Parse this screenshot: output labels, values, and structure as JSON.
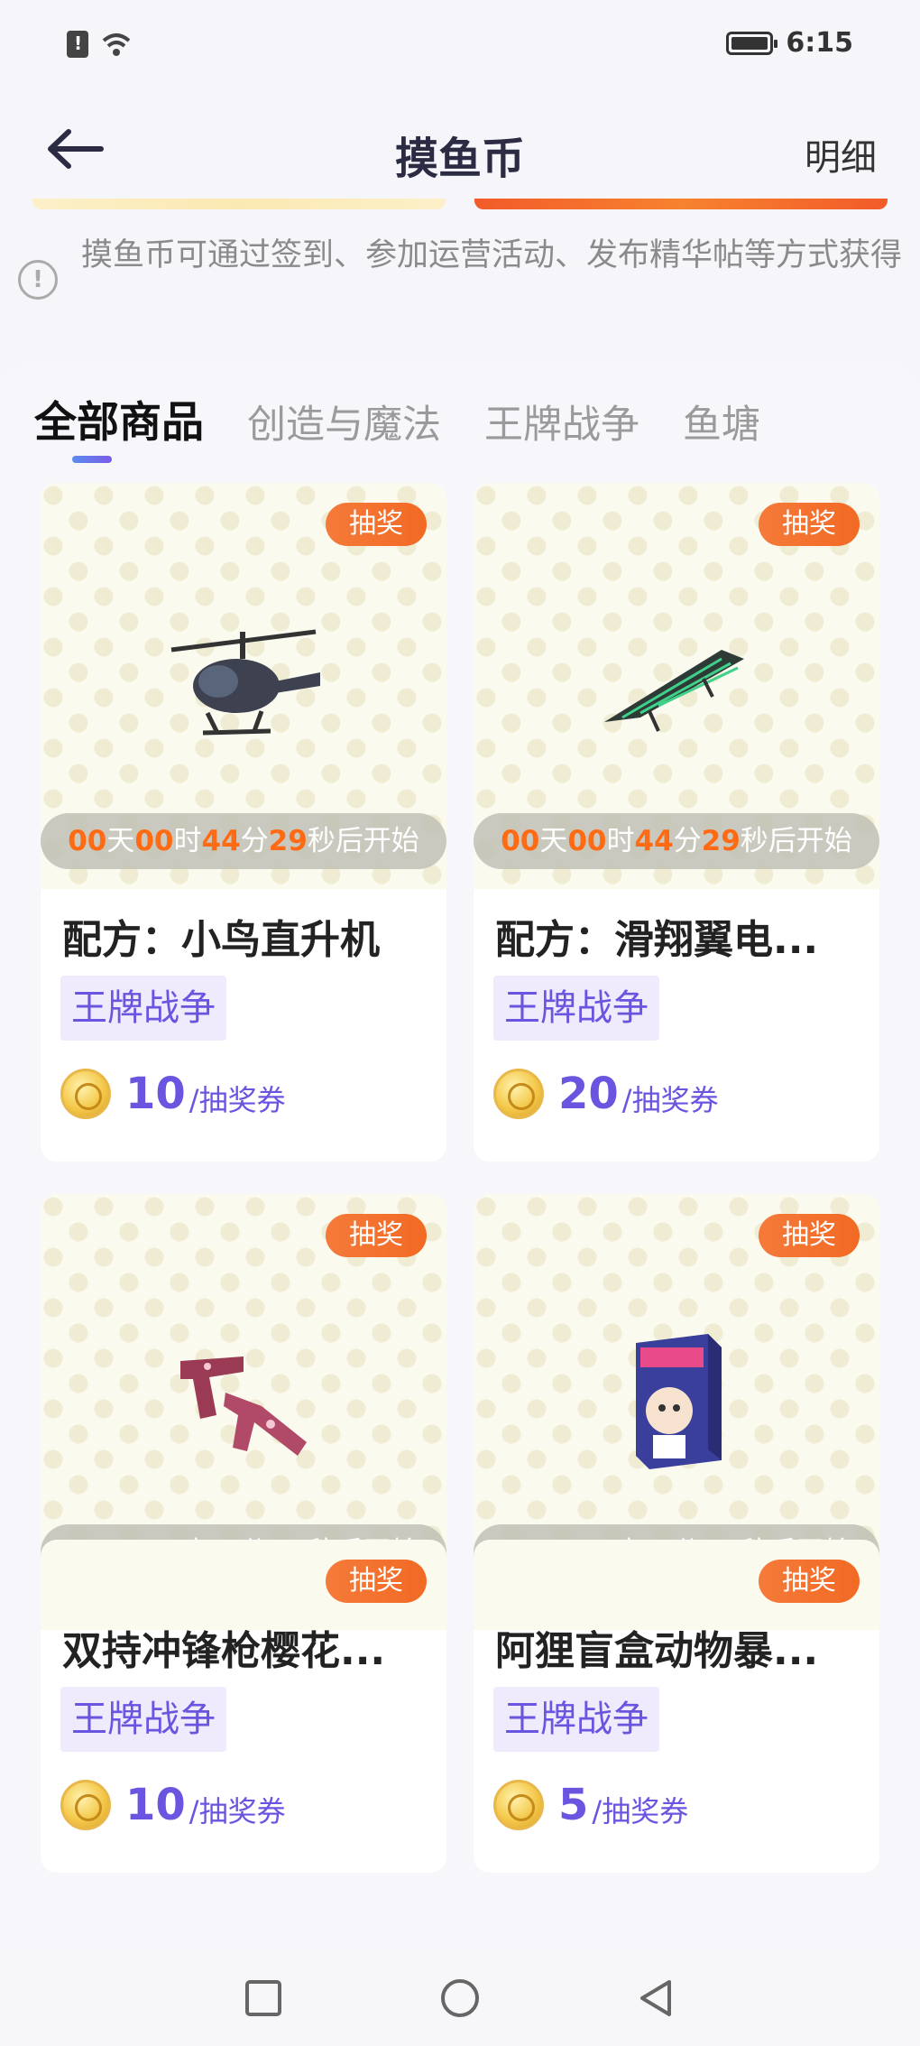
{
  "status_bar": {
    "time": "6:15"
  },
  "header": {
    "title": "摸鱼币",
    "detail_link": "明细"
  },
  "notice": {
    "text": "摸鱼币可通过签到、参加运营活动、发布精华帖等方式获得"
  },
  "tabs": [
    {
      "label": "全部商品",
      "active": true
    },
    {
      "label": "创造与魔法",
      "active": false
    },
    {
      "label": "王牌战争",
      "active": false
    },
    {
      "label": "鱼塘",
      "active": false
    }
  ],
  "countdown": {
    "days": "00",
    "hours": "00",
    "minutes": "44",
    "seconds": "29",
    "unit_day": "天",
    "unit_hour": "时",
    "unit_min": "分",
    "suffix": "秒后开始"
  },
  "products": [
    {
      "badge": "抽奖",
      "title": "配方：小鸟直升机",
      "tag": "王牌战争",
      "price": "10",
      "unit": "/抽奖券",
      "art": "helicopter-image"
    },
    {
      "badge": "抽奖",
      "title": "配方：滑翔翼电...",
      "tag": "王牌战争",
      "price": "20",
      "unit": "/抽奖券",
      "art": "glider-image"
    },
    {
      "badge": "抽奖",
      "title": "双持冲锋枪樱花...",
      "tag": "王牌战争",
      "price": "10",
      "unit": "/抽奖券",
      "art": "dual-smg-image"
    },
    {
      "badge": "抽奖",
      "title": "阿狸盲盒动物暴...",
      "tag": "王牌战争",
      "price": "5",
      "unit": "/抽奖券",
      "art": "blind-box-image"
    }
  ],
  "peek_badge": "抽奖",
  "colors": {
    "accent": "#6a55e0",
    "badge": "#f26a24",
    "countdown_num": "#ff6a12"
  }
}
